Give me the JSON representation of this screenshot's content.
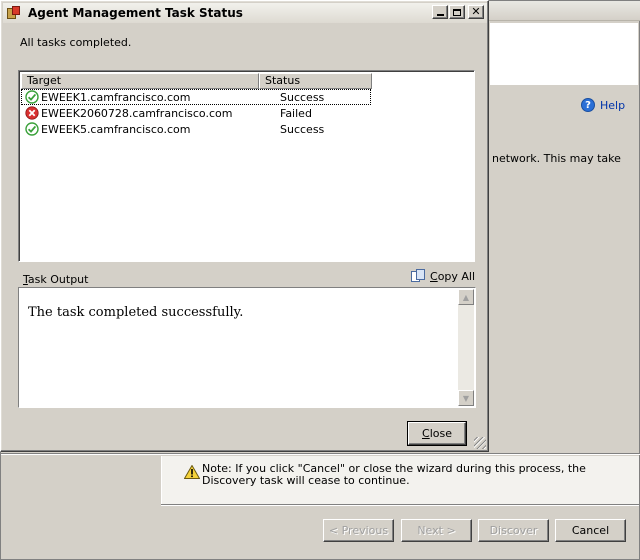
{
  "background_window": {
    "help_label": "Help",
    "network_text": "network. This may take",
    "note_text": "Note:  If you click \"Cancel\" or close the wizard during this process, the Discovery task will cease to continue.",
    "buttons": {
      "previous": "< Previous",
      "next": "Next >",
      "discover": "Discover",
      "cancel": "Cancel"
    }
  },
  "dialog": {
    "title": "Agent Management Task Status",
    "status_message": "All tasks completed.",
    "columns": [
      "Target",
      "Status"
    ],
    "rows": [
      {
        "target": "EWEEK1.camfrancisco.com",
        "status": "Success",
        "icon": "success-check-icon"
      },
      {
        "target": "EWEEK2060728.camfrancisco.com",
        "status": "Failed",
        "icon": "failed-x-icon"
      },
      {
        "target": "EWEEK5.camfrancisco.com",
        "status": "Success",
        "icon": "success-check-icon"
      }
    ],
    "task_output_label_accel": "T",
    "task_output_label_rest": "ask Output",
    "copy_all_accel": "C",
    "copy_all_rest": "opy All",
    "output_text": "The task completed successfully.",
    "close_accel": "C",
    "close_rest": "lose"
  },
  "colors": {
    "success": "#3aa13a",
    "failed": "#d83030",
    "chrome": "#d4d0c8",
    "link": "#0033aa"
  }
}
